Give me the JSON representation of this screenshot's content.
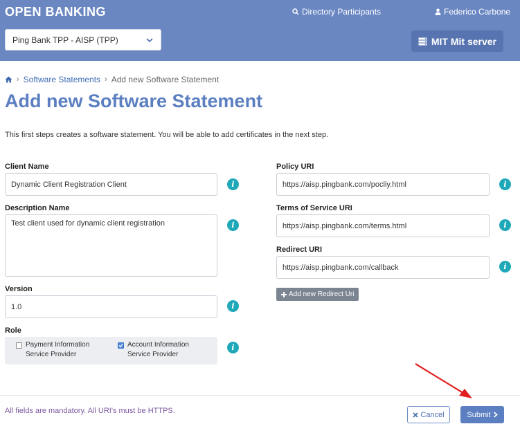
{
  "header": {
    "brand": "OPEN BANKING",
    "directory_label": "Directory Participants",
    "user_label": "Federico Carbone",
    "org_select": "Ping Bank TPP - AISP (TPP)",
    "server_button": "MIT Mit server"
  },
  "breadcrumb": {
    "items": [
      "Software Statements",
      "Add new Software Statement"
    ]
  },
  "page": {
    "title": "Add new Software Statement",
    "intro": "This first steps creates a software statement. You will be able to add certificates in the next step."
  },
  "form": {
    "client_name": {
      "label": "Client Name",
      "value": "Dynamic Client Registration Client"
    },
    "description": {
      "label": "Description Name",
      "value": "Test client used for dynamic client registration"
    },
    "version": {
      "label": "Version",
      "value": "1.0"
    },
    "role": {
      "label": "Role",
      "options": [
        {
          "line1": "Payment Information",
          "line2": "Service Provider",
          "checked": false
        },
        {
          "line1": "Account Information",
          "line2": "Service Provider",
          "checked": true
        }
      ]
    },
    "policy_uri": {
      "label": "Policy URI",
      "value": "https://aisp.pingbank.com/pocliy.html"
    },
    "tos_uri": {
      "label": "Terms of Service URI",
      "value": "https://aisp.pingbank.com/terms.html"
    },
    "redirect_uri": {
      "label": "Redirect URI",
      "value": "https://aisp.pingbank.com/callback"
    },
    "add_redirect_label": "Add new Redirect Uri",
    "info_glyph": "i"
  },
  "footer": {
    "note": "All fields are mandatory. All URI's must be HTTPS.",
    "cancel_label": "Cancel",
    "submit_label": "Submit"
  },
  "colors": {
    "header": "#6a87c2",
    "title": "#5b7fc1",
    "info": "#1fa9b8",
    "annotation_arrow": "#e02020"
  },
  "icons": [
    "search-icon",
    "user-icon",
    "chevron-down-icon",
    "server-icon",
    "home-icon",
    "info-icon",
    "plus-icon",
    "close-icon",
    "chevron-right-icon"
  ]
}
